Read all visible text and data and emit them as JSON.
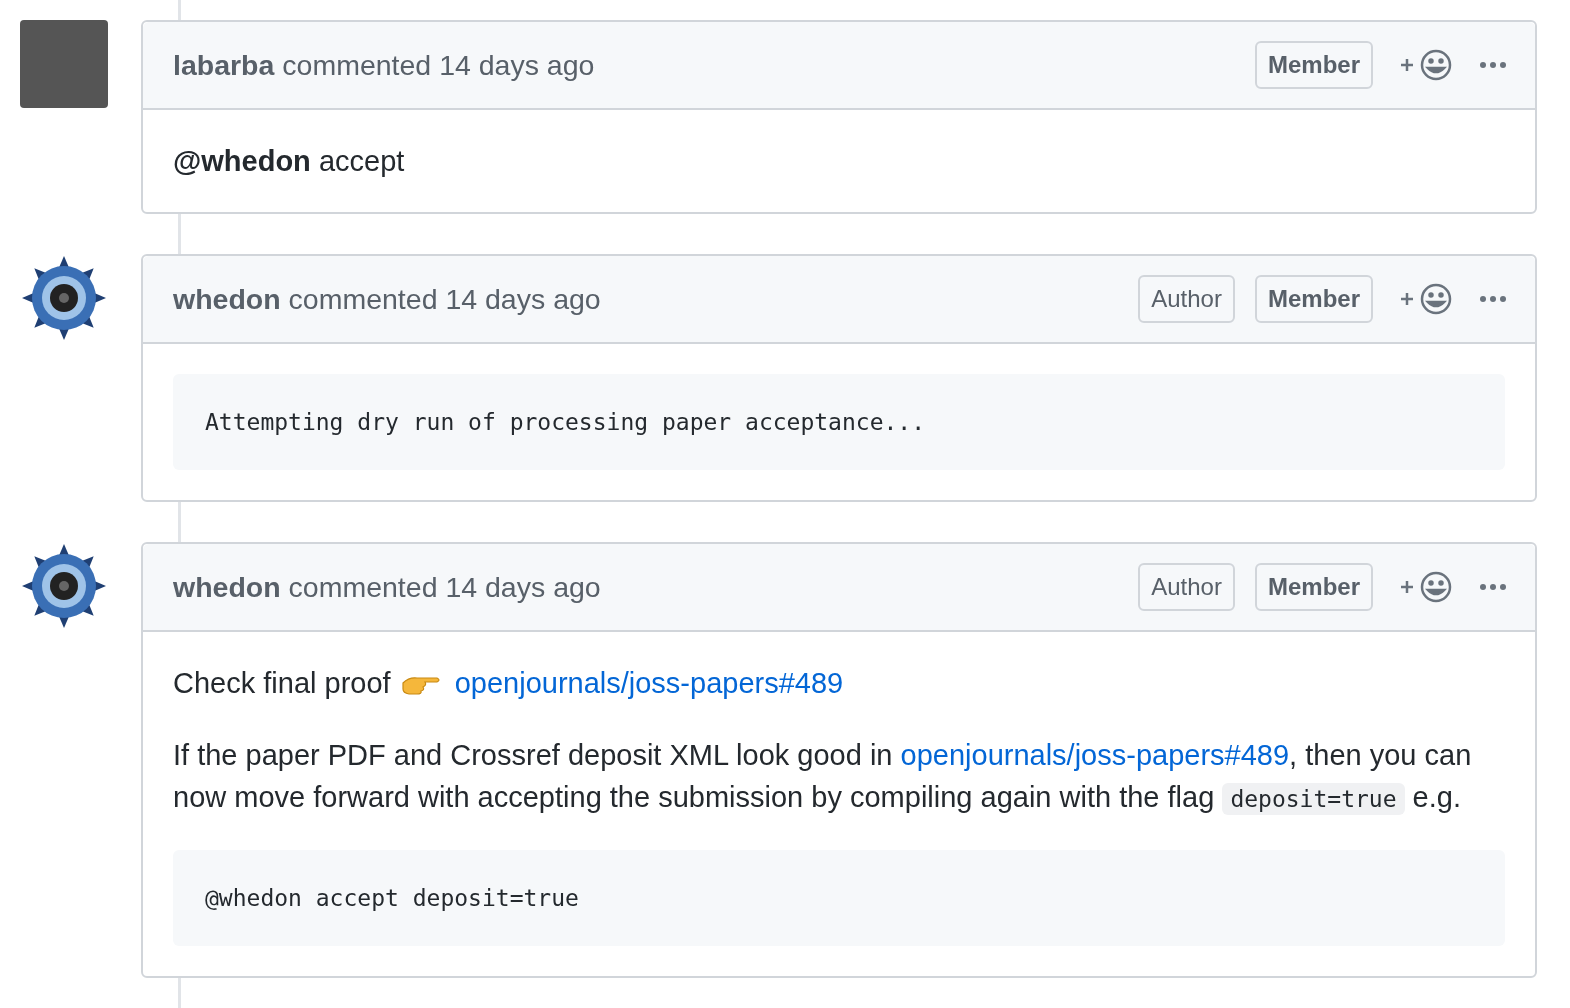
{
  "comments": [
    {
      "author": "labarba",
      "action": "commented 14 days ago",
      "avatar": {
        "kind": "photo"
      },
      "badges": [
        {
          "kind": "member",
          "text": "Member"
        }
      ],
      "body": [
        {
          "kind": "paragraph",
          "segments": [
            {
              "kind": "text",
              "text": "**@whedon** accept"
            }
          ]
        }
      ]
    },
    {
      "author": "whedon",
      "action": "commented 14 days ago",
      "avatar": {
        "kind": "logo"
      },
      "badges": [
        {
          "kind": "author",
          "text": "Author"
        },
        {
          "kind": "member",
          "text": "Member"
        }
      ],
      "body": [
        {
          "kind": "code",
          "text": "Attempting dry run of processing paper acceptance..."
        }
      ]
    },
    {
      "author": "whedon",
      "action": "commented 14 days ago",
      "avatar": {
        "kind": "logo"
      },
      "badges": [
        {
          "kind": "author",
          "text": "Author"
        },
        {
          "kind": "member",
          "text": "Member"
        }
      ],
      "body": [
        {
          "kind": "paragraph",
          "segments": [
            {
              "kind": "text",
              "text": "Check final proof "
            },
            {
              "kind": "emoji"
            },
            {
              "kind": "link",
              "text": "openjournals/joss-papers#489"
            }
          ]
        },
        {
          "kind": "paragraph",
          "segments": [
            {
              "kind": "text",
              "text": "If the paper PDF and Crossref deposit XML look good in "
            },
            {
              "kind": "link",
              "text": "openjournals/joss-papers#489"
            },
            {
              "kind": "text",
              "text": ", then you can now move forward with accepting the submission by compiling again with the flag "
            },
            {
              "kind": "inline_code",
              "text": "deposit=true"
            },
            {
              "kind": "text",
              "text": " e.g."
            }
          ]
        },
        {
          "kind": "code",
          "text": "@whedon accept deposit=true"
        }
      ]
    }
  ]
}
